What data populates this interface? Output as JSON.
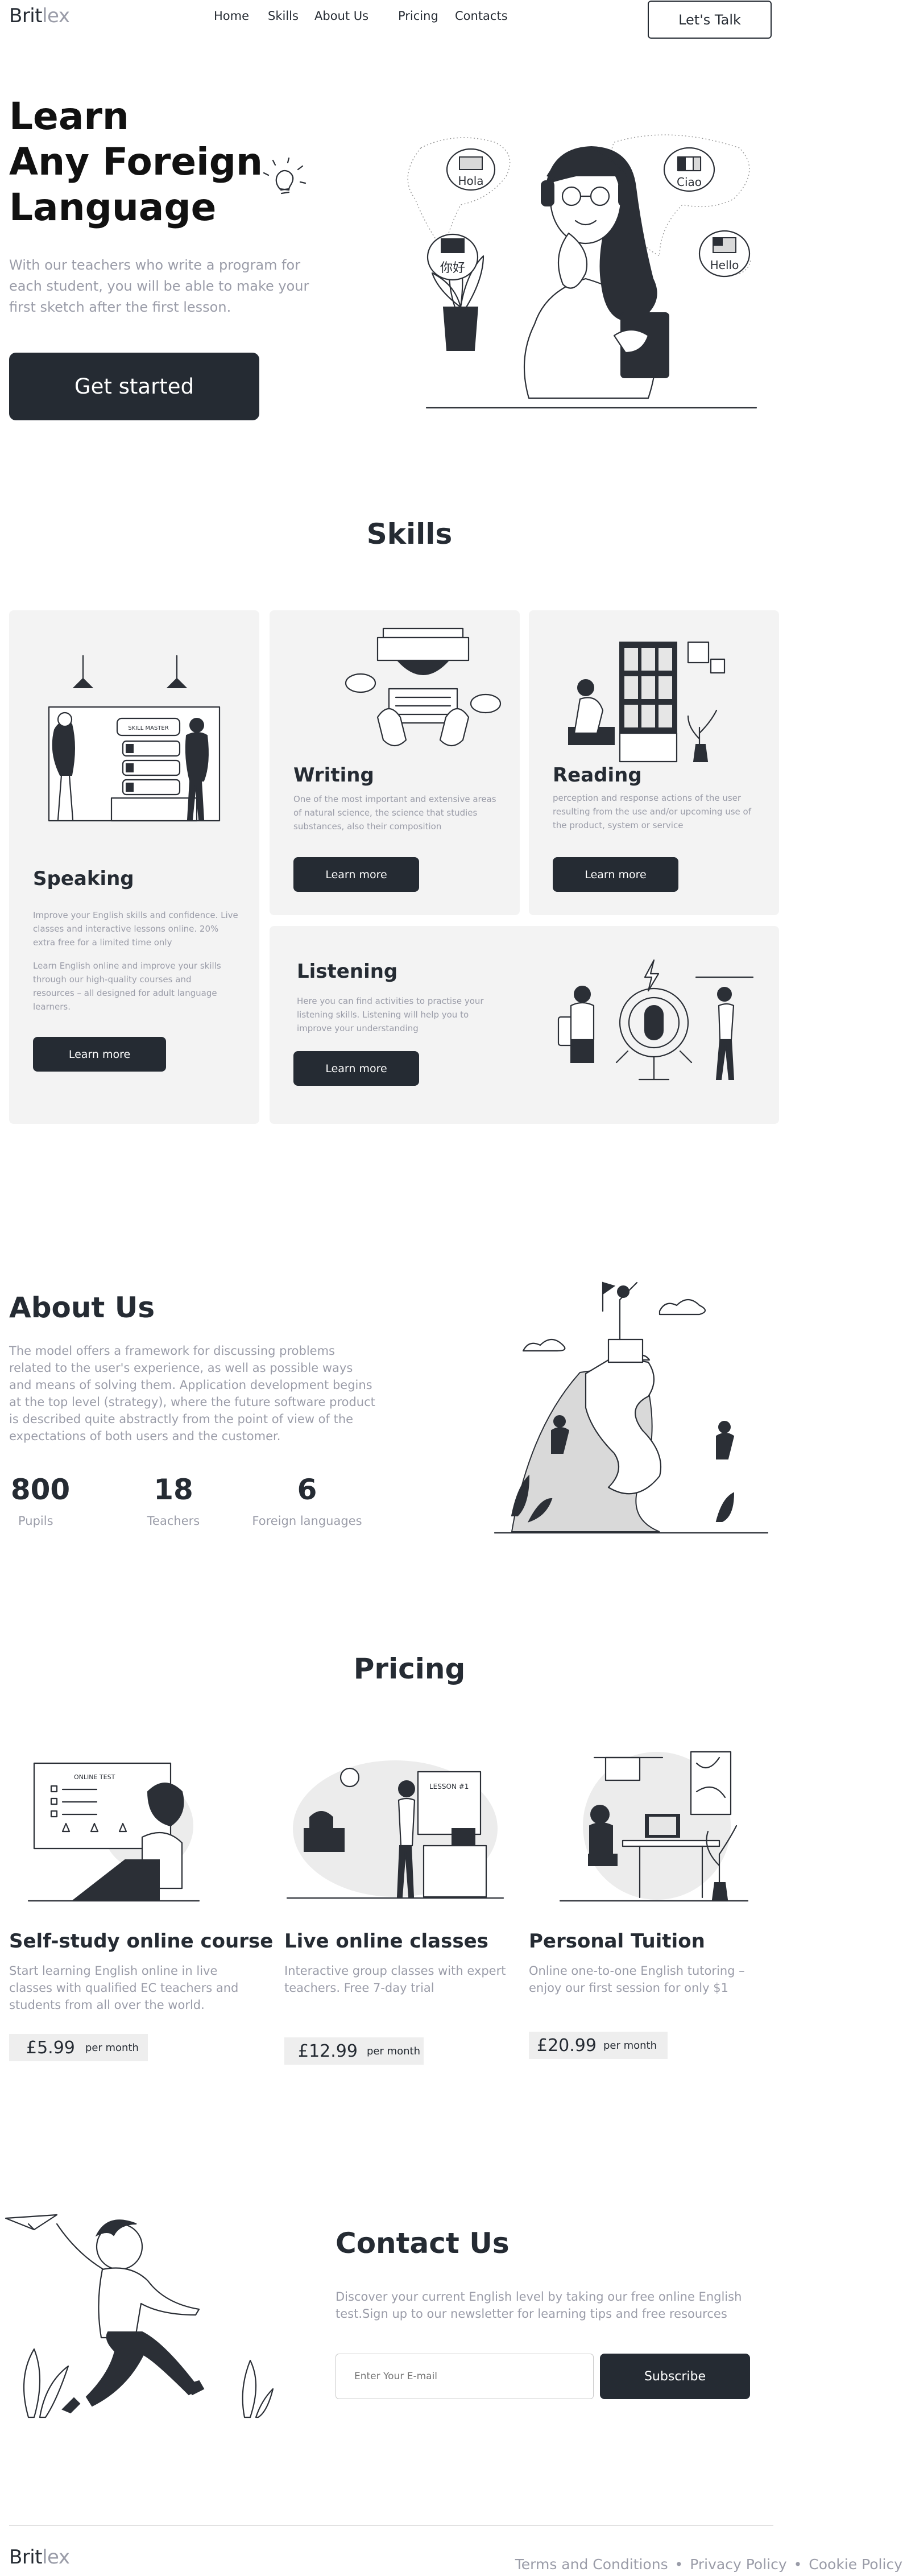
{
  "nav": {
    "logo_a": "Brit",
    "logo_b": "lex",
    "links": [
      "Home",
      "Skills",
      "About Us",
      "Pricing",
      "Contacts"
    ],
    "cta": "Let's Talk"
  },
  "hero": {
    "title": [
      "Learn",
      "Any Foreign",
      "Language"
    ],
    "subtitle": "With our teachers who write a program for each student, you will be able to make your first sketch after the first lesson.",
    "button": "Get started",
    "bubbles": [
      "Hola",
      "Ciao",
      "你好",
      "Hello"
    ]
  },
  "skills": {
    "heading": "Skills",
    "cards": [
      {
        "title": "Speaking",
        "text1": "Improve your English skills and confidence. Live classes and interactive lessons online. 20% extra free for a limited time only",
        "text2": "Learn English online and improve your skills through our high-quality courses and resources – all designed for adult language learners.",
        "button": "Learn more",
        "board": "SKILL MASTER"
      },
      {
        "title": "Writing",
        "text": "One of the most important and extensive areas of natural science, the science that studies substances, also their composition",
        "button": "Learn more"
      },
      {
        "title": "Reading",
        "text": "perception and response actions of the user resulting from the use and/or upcoming use of the product, system or service",
        "button": "Learn more"
      },
      {
        "title": "Listening",
        "text": "Here you can find activities to practise your listening skills. Listening will help you to improve your understanding",
        "button": "Learn more"
      }
    ]
  },
  "about": {
    "heading": "About Us",
    "text": "The model offers a framework for discussing problems related to the user's experience, as well as possible ways and means of solving them. Application development begins at the top level (strategy), where the future software product is described quite abstractly from the point of view of the expectations of both users and the customer.",
    "stats": [
      {
        "value": "800",
        "label": "Pupils"
      },
      {
        "value": "18",
        "label": "Teachers"
      },
      {
        "value": "6",
        "label": "Foreign languages"
      }
    ]
  },
  "pricing": {
    "heading": "Pricing",
    "plans": [
      {
        "title": "Self-study online course",
        "text": "Start learning English online in live classes with qualified EC teachers and students from all over the world.",
        "price": "£5.99",
        "period": "per month",
        "art": "ONLINE TEST"
      },
      {
        "title": "Live online classes",
        "text": "Interactive group classes with expert teachers. Free 7-day trial",
        "price": "£12.99",
        "period": "per month",
        "art": "LESSON #1"
      },
      {
        "title": "Personal Tuition",
        "text": "Online one-to-one English tutoring – enjoy our first session for only $1",
        "price": "£20.99",
        "period": "per month"
      }
    ]
  },
  "contact": {
    "heading": "Contact Us",
    "text": "Discover your current English level by taking our free online English test.Sign up to our newsletter for learning tips and free resources",
    "placeholder": "Enter Your E-mail",
    "button": "Subscribe"
  },
  "footer": {
    "logo_a": "Brit",
    "logo_b": "lex",
    "links": [
      "Terms and Conditions",
      "Privacy Policy",
      "Cookie Policy"
    ],
    "separator": "•"
  },
  "colors": {
    "dark": "#252b33",
    "muted": "#9a9ca8",
    "card": "#f3f3f3"
  }
}
